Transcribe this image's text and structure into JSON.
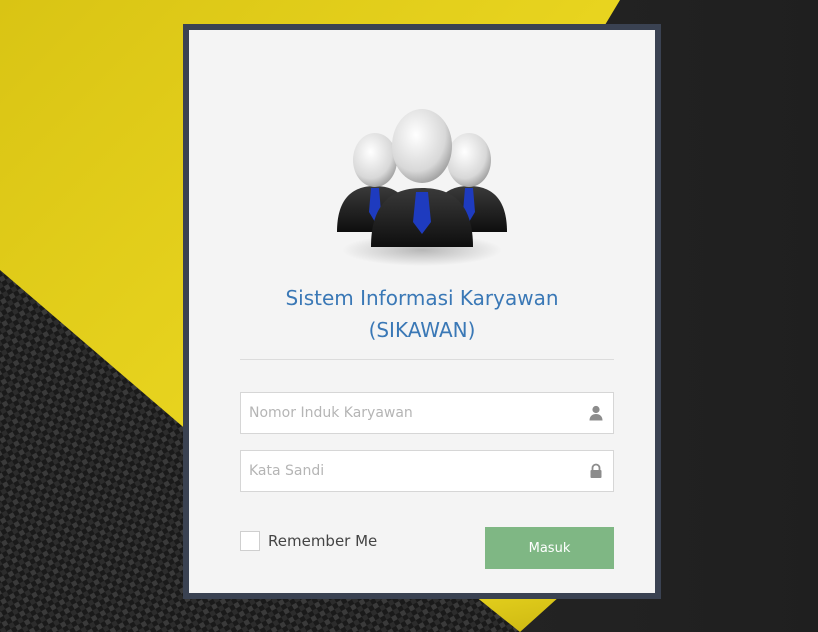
{
  "app": {
    "title_line1": "Sistem Informasi Karyawan",
    "title_line2": "(SIKAWAN)"
  },
  "form": {
    "nik_placeholder": "Nomor Induk Karyawan",
    "nik_value": "",
    "password_placeholder": "Kata Sandi",
    "password_value": "",
    "remember_label": "Remember Me",
    "remember_checked": false,
    "submit_label": "Masuk"
  },
  "icons": {
    "logo": "users-group-icon",
    "nik": "user-icon",
    "password": "lock-icon"
  },
  "colors": {
    "title": "#3a78b6",
    "button": "#7fb784",
    "card_border": "#3a4252",
    "background_yellow": "#e3cf1a"
  }
}
